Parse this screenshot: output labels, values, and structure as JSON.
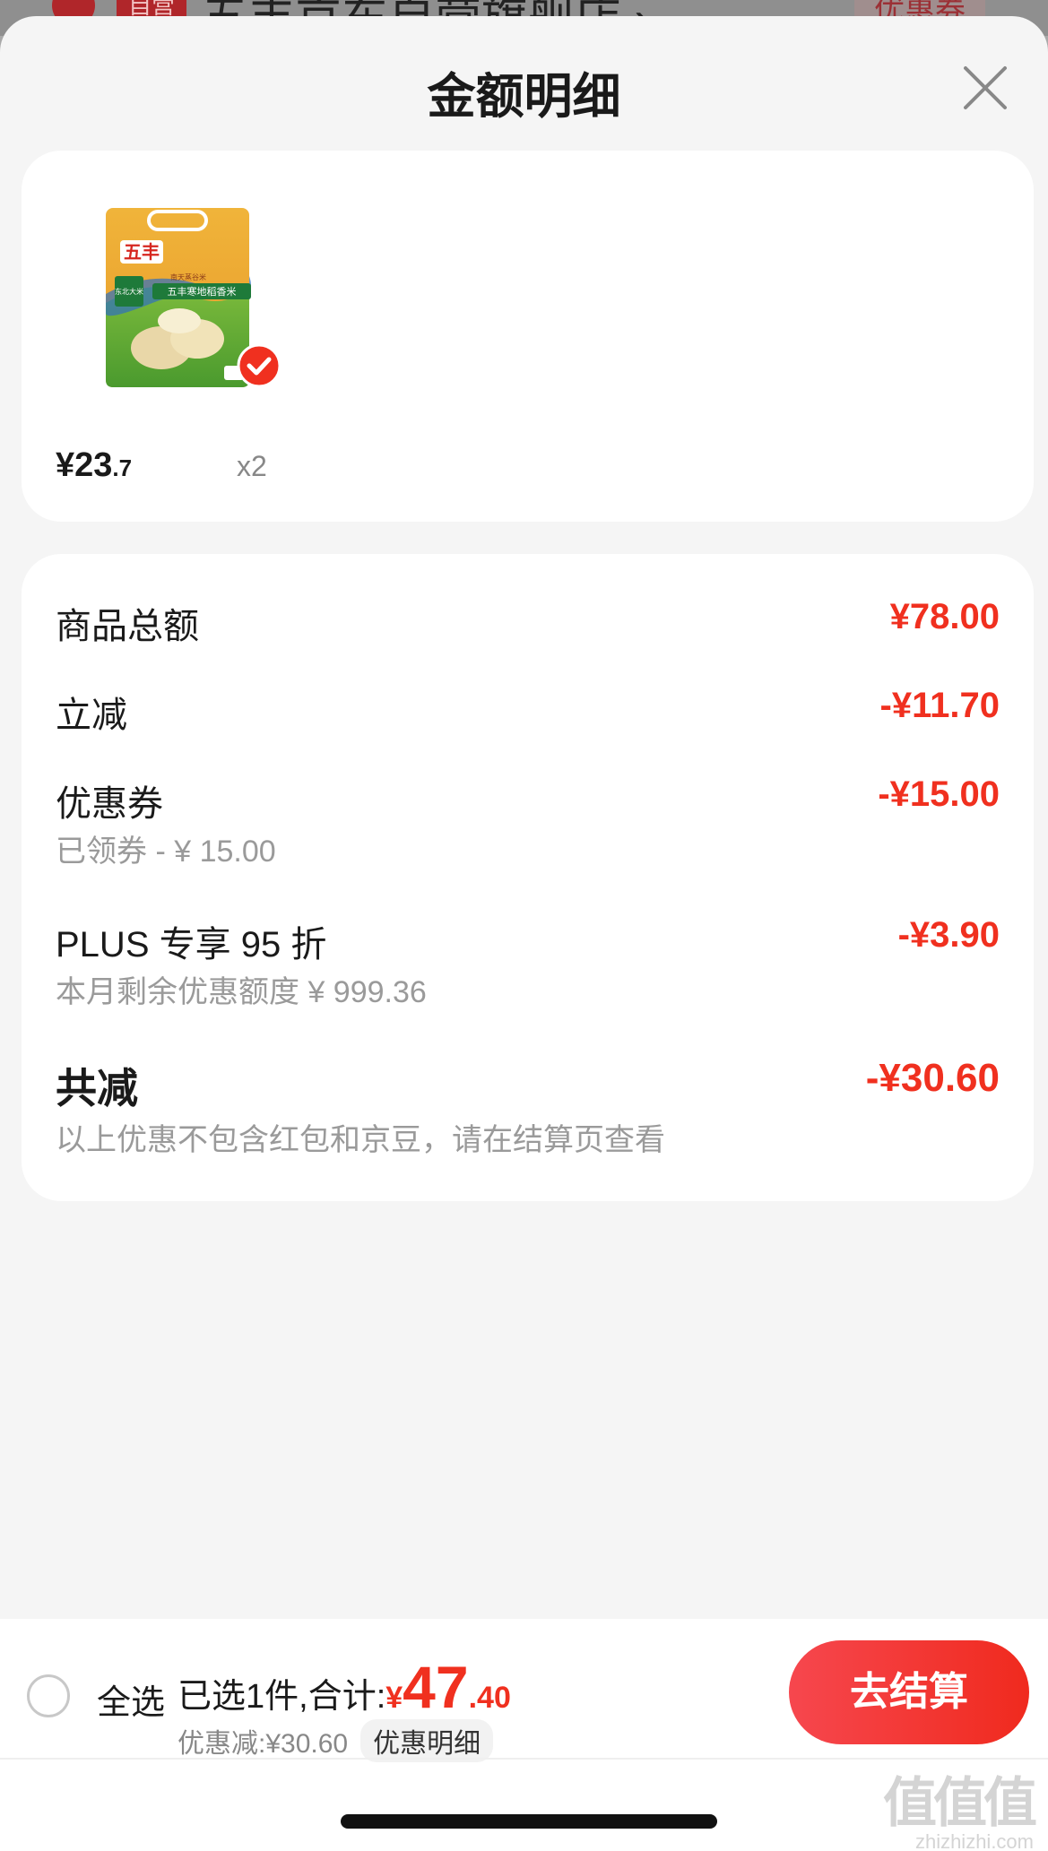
{
  "background": {
    "store_badge": "自营",
    "store_name": "五丰京东自营旗舰店 ›",
    "coupon_label": "优惠券"
  },
  "sheet": {
    "title": "金额明细"
  },
  "product": {
    "price_int": "¥23",
    "price_dec": ".7",
    "quantity": "x2",
    "image_text": {
      "brand": "五丰",
      "ribbon": "南天蒸谷米",
      "tag": "东北大米",
      "name": "五丰寒地稻香米"
    }
  },
  "details": {
    "rows": [
      {
        "label": "商品总额",
        "value": "¥78.00"
      },
      {
        "label": "立减",
        "value": "-¥11.70"
      },
      {
        "label": "优惠券",
        "value": "-¥15.00",
        "sub": "已领券 - ¥ 15.00"
      },
      {
        "label": "PLUS 专享 95 折",
        "value": "-¥3.90",
        "sub": "本月剩余优惠额度  ¥ 999.36"
      }
    ],
    "total": {
      "label": "共减",
      "value": "-¥30.60",
      "sub": "以上优惠不包含红包和京豆，请在结算页查看"
    }
  },
  "bottom_bar": {
    "select_all": "全选",
    "summary_prefix": "已选1件,合计:",
    "total_yen": "¥",
    "total_int": "47",
    "total_dec": ".40",
    "discount": "优惠减:¥30.60",
    "detail_link": "优惠明细",
    "checkout": "去结算"
  },
  "watermark": {
    "logo": "值值值",
    "url": "zhizhizhi.com"
  },
  "colors": {
    "accent_red": "#f0301f",
    "sheet_bg": "#f5f5f5",
    "card_bg": "#ffffff"
  }
}
